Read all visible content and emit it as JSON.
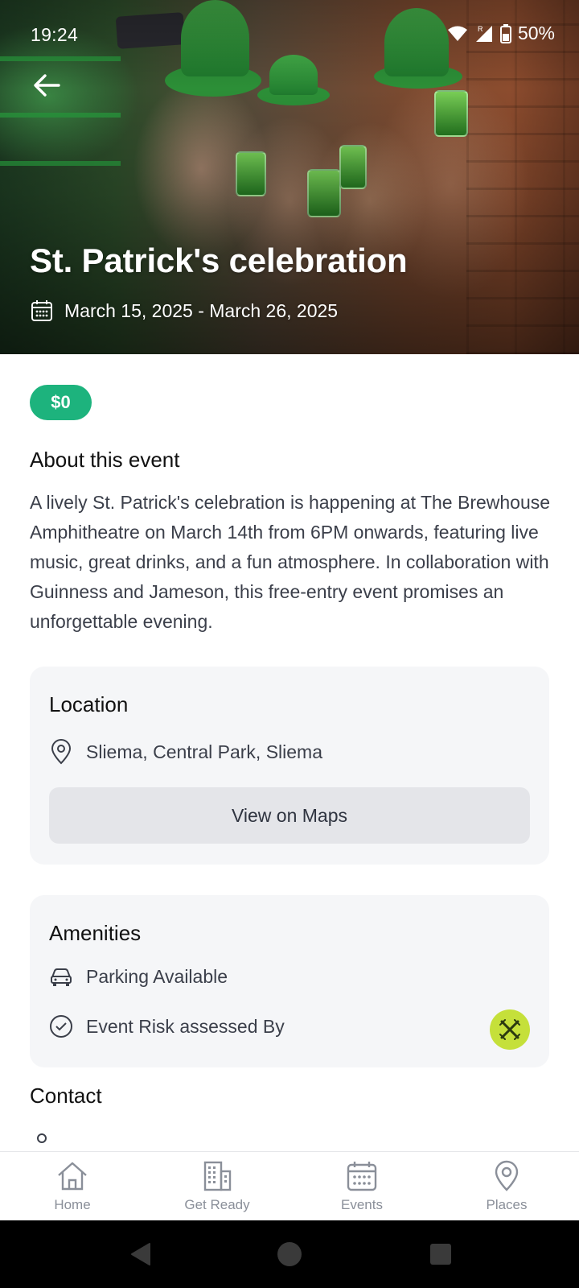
{
  "status_bar": {
    "time": "19:24",
    "battery": "50%",
    "icons": [
      "wifi-icon",
      "signal-icon",
      "battery-icon"
    ]
  },
  "event": {
    "title": "St. Patrick's celebration",
    "dates": "March 15, 2025 - March 26, 2025",
    "price": "$0"
  },
  "about": {
    "heading": "About this event",
    "text": "A lively St. Patrick's celebration is happening at The Brewhouse Amphitheatre on March 14th from 6PM onwards, featuring live music, great drinks, and a fun atmosphere. In collaboration with Guinness and Jameson, this free-entry event promises an unforgettable evening."
  },
  "location": {
    "heading": "Location",
    "address": "Sliema, Central Park, Sliema",
    "maps_button": "View on Maps"
  },
  "amenities": {
    "heading": "Amenities",
    "items": [
      {
        "icon": "car-icon",
        "label": "Parking Available"
      },
      {
        "icon": "check-circle-icon",
        "label": "Event Risk assessed By"
      }
    ]
  },
  "contact": {
    "heading": "Contact"
  },
  "nav": {
    "items": [
      {
        "icon": "home-icon",
        "label": "Home"
      },
      {
        "icon": "building-icon",
        "label": "Get Ready"
      },
      {
        "icon": "calendar-icon",
        "label": "Events"
      },
      {
        "icon": "map-pin-icon",
        "label": "Places"
      }
    ]
  },
  "colors": {
    "accent_green": "#1db37d",
    "risk_logo": "#c5e03a",
    "card_bg": "#f5f6f8"
  }
}
